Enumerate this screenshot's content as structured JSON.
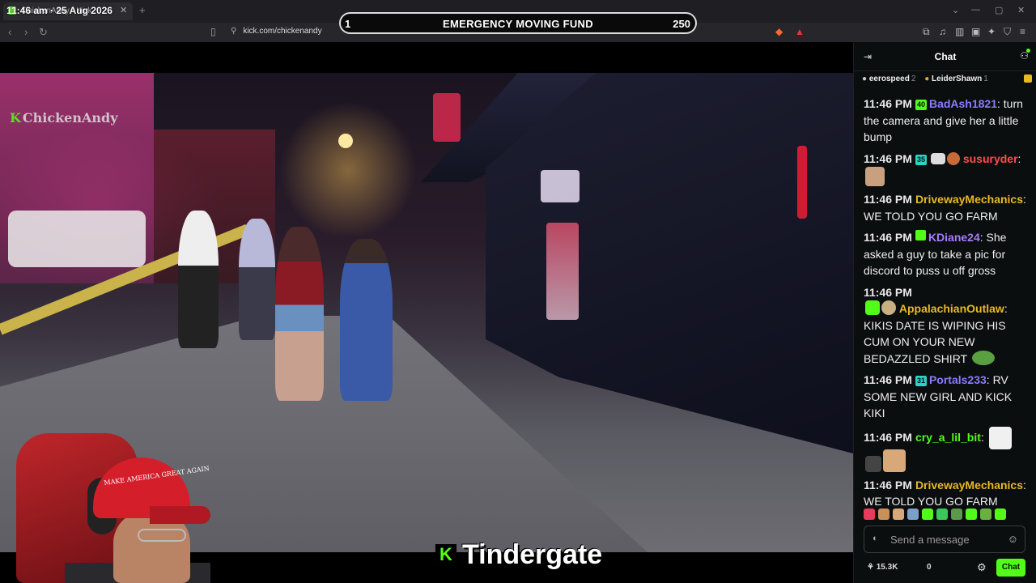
{
  "browser": {
    "tab_title": "ChickenAndy - Kick",
    "clock": "11:46 am · 25 Aug 2026",
    "url": "kick.com/chickenandy"
  },
  "fund": {
    "left_value": "1",
    "title": "EMERGENCY MOVING FUND",
    "right_value": "250"
  },
  "video": {
    "watermark": "ChickenAndy",
    "hat_text": "MAKE AMERICA GREAT AGAIN",
    "stream_title": "Tindergate",
    "stream_logo": "K"
  },
  "chat": {
    "title": "Chat",
    "gifters": [
      {
        "name": "eerospeed",
        "count": "2"
      },
      {
        "name": "LeiderShawn",
        "count": "1"
      }
    ],
    "messages": [
      {
        "time": "11:46 PM",
        "user": "BadAsh1821",
        "badge": "40",
        "color": "#8c7bff",
        "text": "turn the camera and give her a little bump"
      },
      {
        "time": "11:46 PM",
        "user": "susuryder",
        "badge": "35",
        "color": "#ff4d4d",
        "text": ""
      },
      {
        "time": "11:46 PM",
        "user": "DrivewayMechanics",
        "badge": "",
        "color": "#e8b923",
        "text": "WE TOLD YOU GO FARM"
      },
      {
        "time": "11:46 PM",
        "user": "KDiane24",
        "badge": "",
        "color": "#a77bff",
        "text": "She asked a guy to take a pic for discord to puss u off gross"
      },
      {
        "time": "11:46 PM",
        "user": "AppalachianOutlaw",
        "badge": "",
        "color": "#e8b923",
        "text": "KIKIS DATE IS WIPING HIS CUM ON YOUR NEW BEDAZZLED SHIRT"
      },
      {
        "time": "11:46 PM",
        "user": "Portals233",
        "badge": "31",
        "color": "#8c7bff",
        "text": "RV SOME NEW GIRL AND KICK KIKI"
      },
      {
        "time": "11:46 PM",
        "user": "cry_a_lil_bit",
        "badge": "",
        "color": "#53fc18",
        "text": ""
      },
      {
        "time": "11:46 PM",
        "user": "DrivewayMechanics",
        "badge": "",
        "color": "#e8b923",
        "text": "WE TOLD YOU GO FARM"
      }
    ],
    "input_placeholder": "Send a message",
    "footer_count_a": "15.3K",
    "footer_count_b": "0",
    "send_label": "Chat"
  }
}
